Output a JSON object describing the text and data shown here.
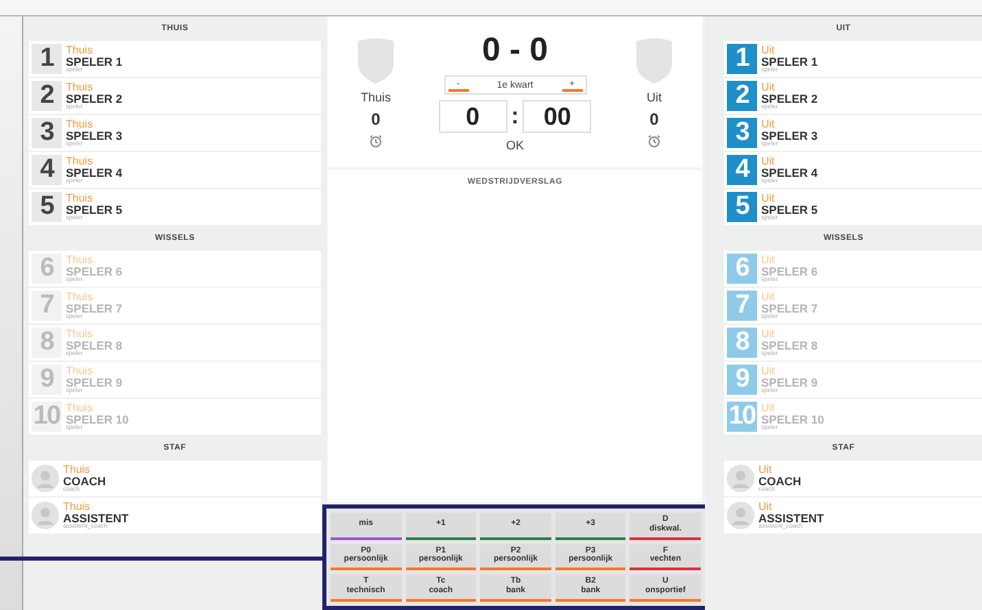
{
  "home": {
    "title": "THUIS",
    "sections": [
      {
        "players": [
          {
            "number": "1",
            "team": "Thuis",
            "name": "SPELER 1",
            "role": "speler",
            "active": true
          },
          {
            "number": "2",
            "team": "Thuis",
            "name": "SPELER 2",
            "role": "speler",
            "active": true
          },
          {
            "number": "3",
            "team": "Thuis",
            "name": "SPELER 3",
            "role": "speler",
            "active": true
          },
          {
            "number": "4",
            "team": "Thuis",
            "name": "SPELER 4",
            "role": "speler",
            "active": true
          },
          {
            "number": "5",
            "team": "Thuis",
            "name": "SPELER 5",
            "role": "speler",
            "active": true
          }
        ]
      },
      {
        "title": "WISSELS",
        "players": [
          {
            "number": "6",
            "team": "Thuis",
            "name": "SPELER 6",
            "role": "speler",
            "active": false
          },
          {
            "number": "7",
            "team": "Thuis",
            "name": "SPELER 7",
            "role": "speler",
            "active": false
          },
          {
            "number": "8",
            "team": "Thuis",
            "name": "SPELER 8",
            "role": "speler",
            "active": false
          },
          {
            "number": "9",
            "team": "Thuis",
            "name": "SPELER 9",
            "role": "speler",
            "active": false
          },
          {
            "number": "10",
            "team": "Thuis",
            "name": "SPELER 10",
            "role": "speler",
            "active": false
          }
        ]
      },
      {
        "title": "STAF",
        "staff": [
          {
            "team": "Thuis",
            "name": "COACH",
            "role": "coach"
          },
          {
            "team": "Thuis",
            "name": "ASSISTENT",
            "role": "assistent_coach"
          }
        ]
      }
    ]
  },
  "scoreboard": {
    "score": "0 - 0",
    "period": {
      "minus": "-",
      "label": "1e kwart",
      "plus": "+"
    },
    "home_name": "Thuis",
    "away_name": "Uit",
    "home_fouls": "0",
    "away_fouls": "0",
    "minutes": "0",
    "separator": ":",
    "seconds": "00",
    "ok": "OK"
  },
  "report": {
    "title": "WEDSTRIJDVERSLAG"
  },
  "actions": [
    {
      "code": "mis",
      "color": "#9b59c6"
    },
    {
      "code": "+1",
      "color": "#2e7d4f"
    },
    {
      "code": "+2",
      "color": "#2e7d4f"
    },
    {
      "code": "+3",
      "color": "#2e7d4f"
    },
    {
      "code": "D",
      "label": "diskwal.",
      "color": "#d9343a"
    },
    {
      "code": "P0",
      "label": "persoonlijk",
      "color": "#f5782b"
    },
    {
      "code": "P1",
      "label": "persoonlijk",
      "color": "#f5782b"
    },
    {
      "code": "P2",
      "label": "persoonlijk",
      "color": "#f5782b"
    },
    {
      "code": "P3",
      "label": "persoonlijk",
      "color": "#f5782b"
    },
    {
      "code": "F",
      "label": "vechten",
      "color": "#d9343a"
    },
    {
      "code": "T",
      "label": "technisch",
      "color": "#f5782b"
    },
    {
      "code": "Tc",
      "label": "coach",
      "color": "#f5782b"
    },
    {
      "code": "Tb",
      "label": "bank",
      "color": "#f5782b"
    },
    {
      "code": "B2",
      "label": "bank",
      "color": "#f5782b"
    },
    {
      "code": "U",
      "label": "onsportief",
      "color": "#f5782b"
    }
  ],
  "away": {
    "title": "UIT",
    "sections": [
      {
        "players": [
          {
            "number": "1",
            "team": "Uit",
            "name": "SPELER 1",
            "role": "speler",
            "active": true
          },
          {
            "number": "2",
            "team": "Uit",
            "name": "SPELER 2",
            "role": "speler",
            "active": true
          },
          {
            "number": "3",
            "team": "Uit",
            "name": "SPELER 3",
            "role": "speler",
            "active": true
          },
          {
            "number": "4",
            "team": "Uit",
            "name": "SPELER 4",
            "role": "speler",
            "active": true
          },
          {
            "number": "5",
            "team": "Uit",
            "name": "SPELER 5",
            "role": "speler",
            "active": true
          }
        ]
      },
      {
        "title": "WISSELS",
        "players": [
          {
            "number": "6",
            "team": "Uit",
            "name": "SPELER 6",
            "role": "speler",
            "active": false
          },
          {
            "number": "7",
            "team": "Uit",
            "name": "SPELER 7",
            "role": "speler",
            "active": false
          },
          {
            "number": "8",
            "team": "Uit",
            "name": "SPELER 8",
            "role": "speler",
            "active": false
          },
          {
            "number": "9",
            "team": "Uit",
            "name": "SPELER 9",
            "role": "speler",
            "active": false
          },
          {
            "number": "10",
            "team": "Uit",
            "name": "SPELER 10",
            "role": "speler",
            "active": false
          }
        ]
      },
      {
        "title": "STAF",
        "staff": [
          {
            "team": "Uit",
            "name": "COACH",
            "role": "coach"
          },
          {
            "team": "Uit",
            "name": "ASSISTENT",
            "role": "assistent_coach"
          }
        ]
      }
    ]
  }
}
